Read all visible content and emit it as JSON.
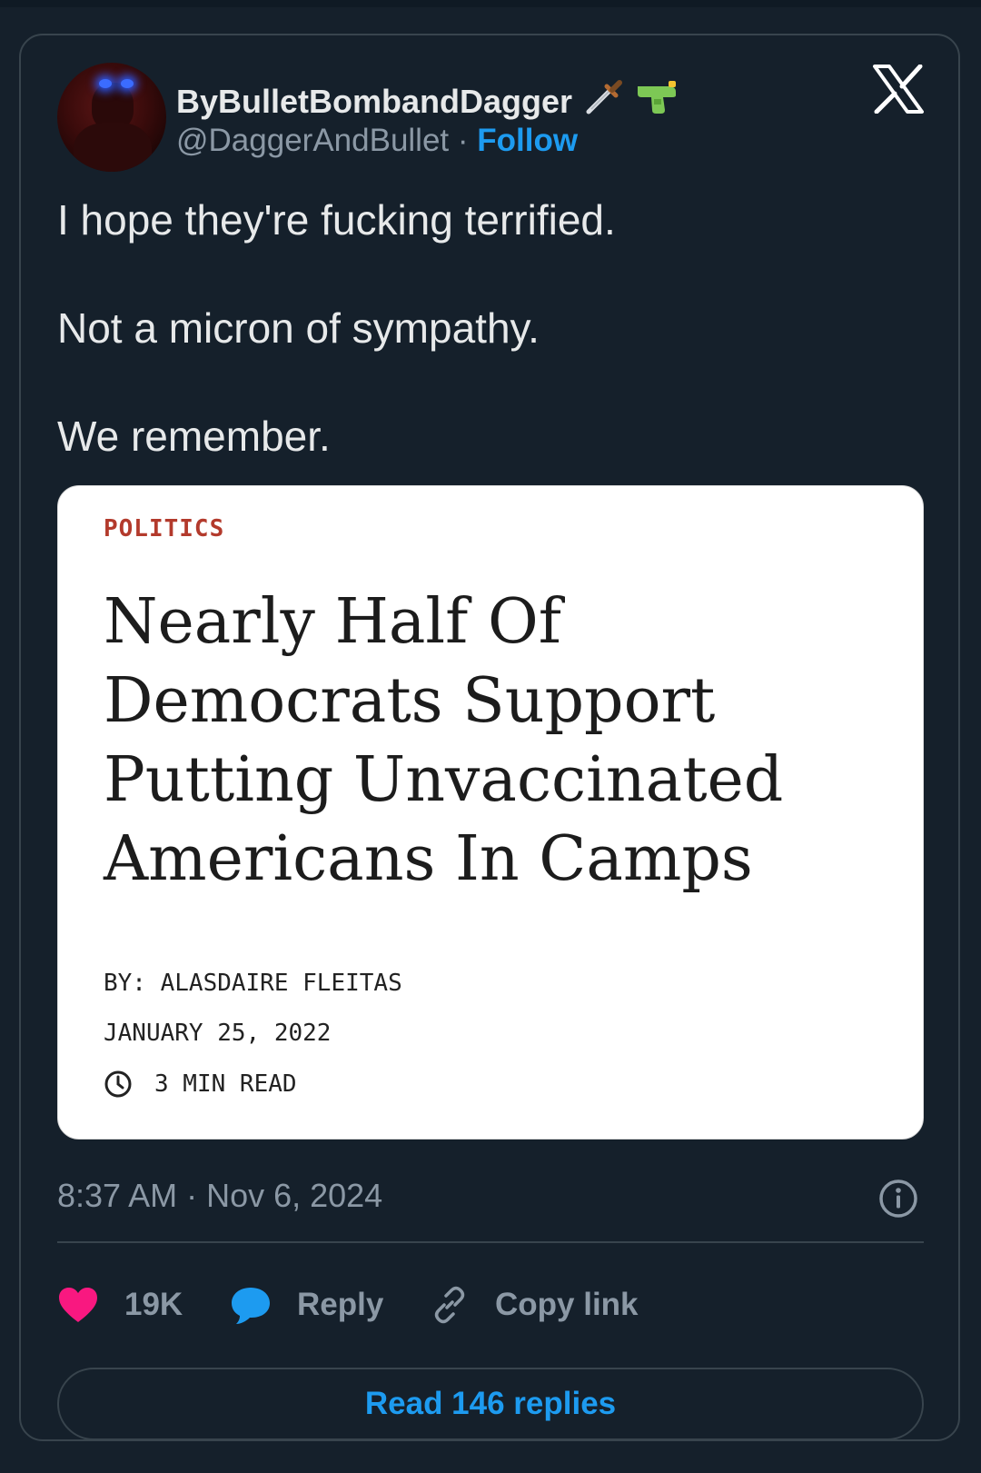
{
  "user": {
    "display_name": "ByBulletBombandDagger",
    "name_emojis": [
      "dagger-icon",
      "water-pistol-icon"
    ],
    "handle": "@DaggerAndBullet",
    "separator": "·",
    "follow_label": "Follow"
  },
  "tweet": {
    "lines": [
      "I hope they're fucking terrified.",
      "Not a micron of sympathy.",
      "We remember."
    ]
  },
  "article": {
    "kicker": "POLITICS",
    "headline": [
      "Nearly Half Of",
      "Democrats Support",
      "Putting Unvaccinated",
      "Americans In Camps"
    ],
    "byline": "BY: ALASDAIRE FLEITAS",
    "date": "JANUARY 25, 2022",
    "read_time": "3 MIN READ"
  },
  "timestamp": "8:37 AM · Nov 6, 2024",
  "actions": {
    "likes": "19K",
    "reply_label": "Reply",
    "copy_link_label": "Copy link"
  },
  "read_replies_label": "Read 146 replies",
  "colors": {
    "background": "#15202b",
    "accent": "#1d9bf0",
    "like": "#f91880",
    "muted": "#8b98a5",
    "kicker": "#b33a2c"
  }
}
